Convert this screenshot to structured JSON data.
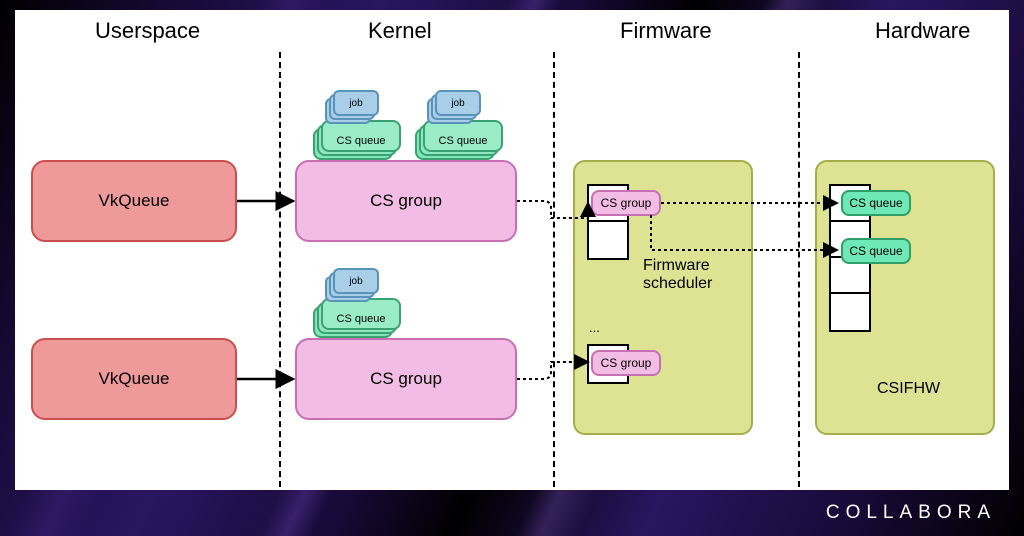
{
  "brand": "COLLABORA",
  "columns": {
    "userspace": "Userspace",
    "kernel": "Kernel",
    "firmware": "Firmware",
    "hardware": "Hardware"
  },
  "userspace": {
    "vkqueue1": "VkQueue",
    "vkqueue2": "VkQueue"
  },
  "kernel": {
    "csgroup1": "CS group",
    "csgroup2": "CS group",
    "csqueue_label": "CS queue",
    "job_label": "job"
  },
  "firmware": {
    "mini_csgroup": "CS group",
    "scheduler_label": "Firmware scheduler",
    "ellipsis": "..."
  },
  "hardware": {
    "mini_csqueue": "CS queue",
    "csifhw_label": "CSIFHW"
  }
}
